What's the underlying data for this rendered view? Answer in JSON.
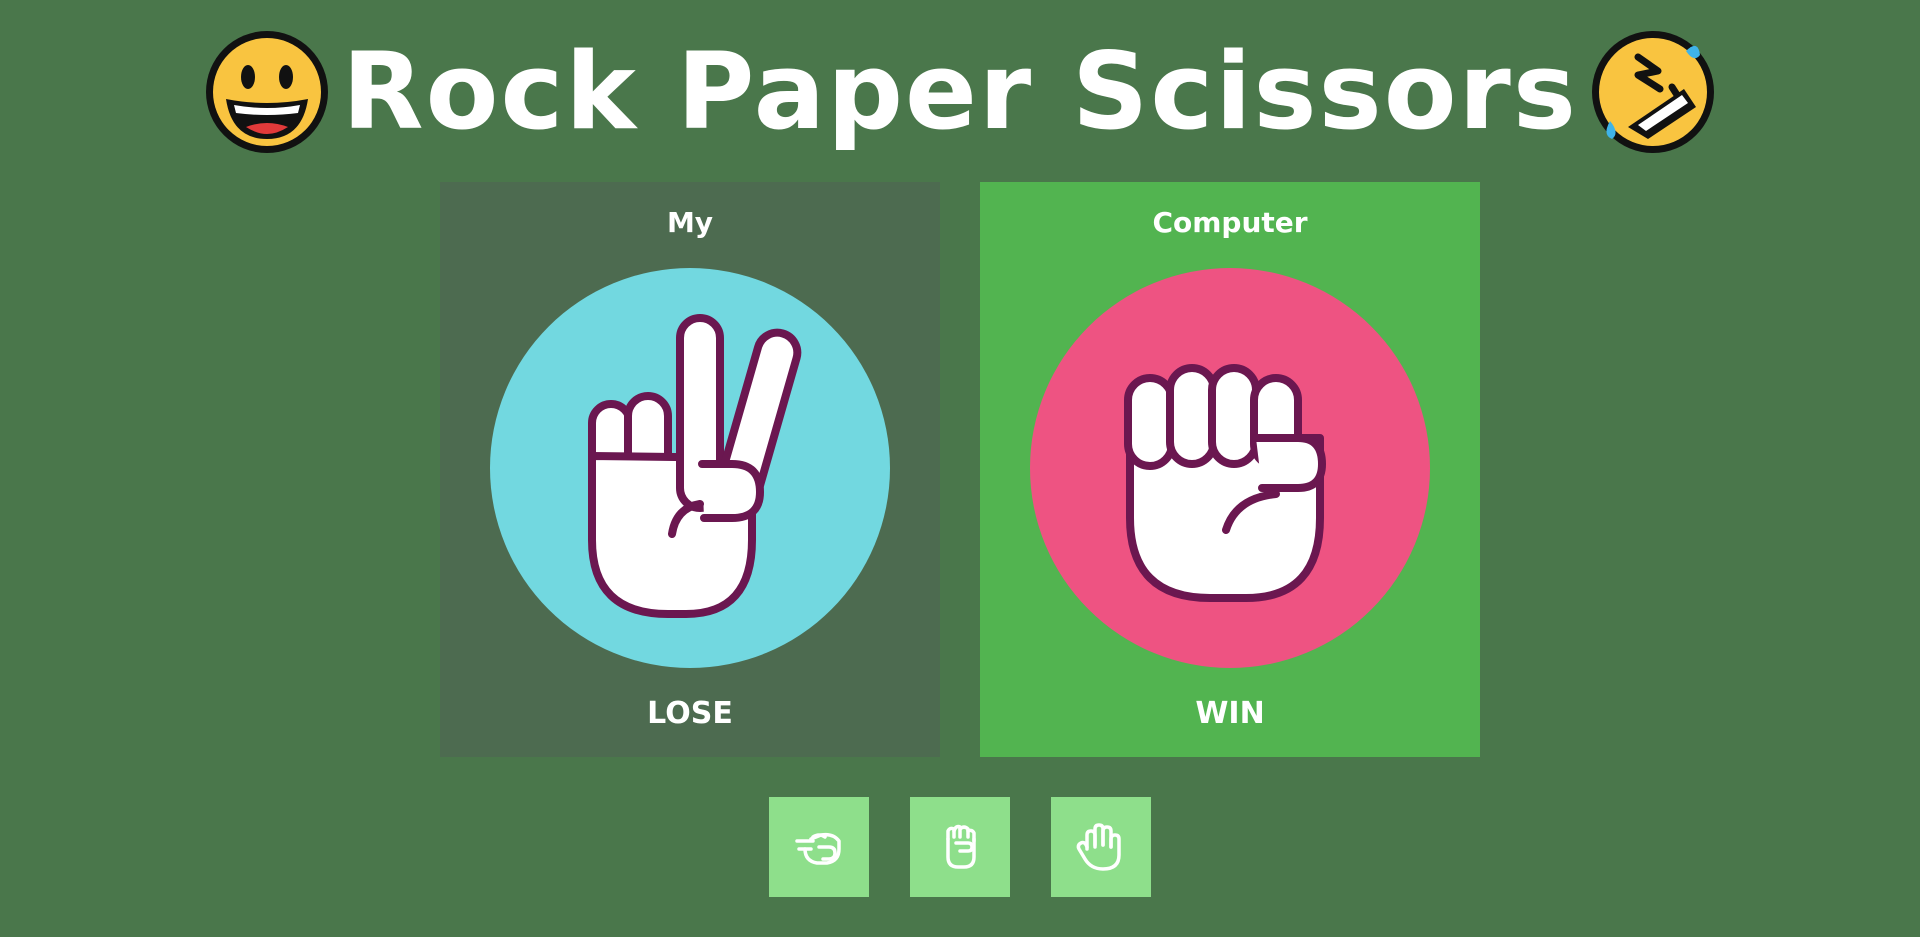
{
  "header": {
    "title": "Rock Paper Scissors",
    "left_icon": "grinning-face-icon",
    "right_icon": "rolling-on-floor-laughing-icon"
  },
  "player": {
    "label": "My",
    "choice_icon": "scissors-hand-icon",
    "result": "LOSE",
    "panel_color": "#4d6b50",
    "circle_color": "#72d8e0"
  },
  "computer": {
    "label": "Computer",
    "choice_icon": "rock-fist-icon",
    "result": "WIN",
    "panel_color": "#52b450",
    "circle_color": "#ee5382"
  },
  "choices": [
    {
      "icon": "scissors-hand-icon"
    },
    {
      "icon": "rock-fist-icon"
    },
    {
      "icon": "paper-hand-icon"
    }
  ],
  "colors": {
    "background": "#4a774b",
    "button": "#8edf8b",
    "hand_outline": "#6b1750",
    "text": "#ffffff"
  }
}
